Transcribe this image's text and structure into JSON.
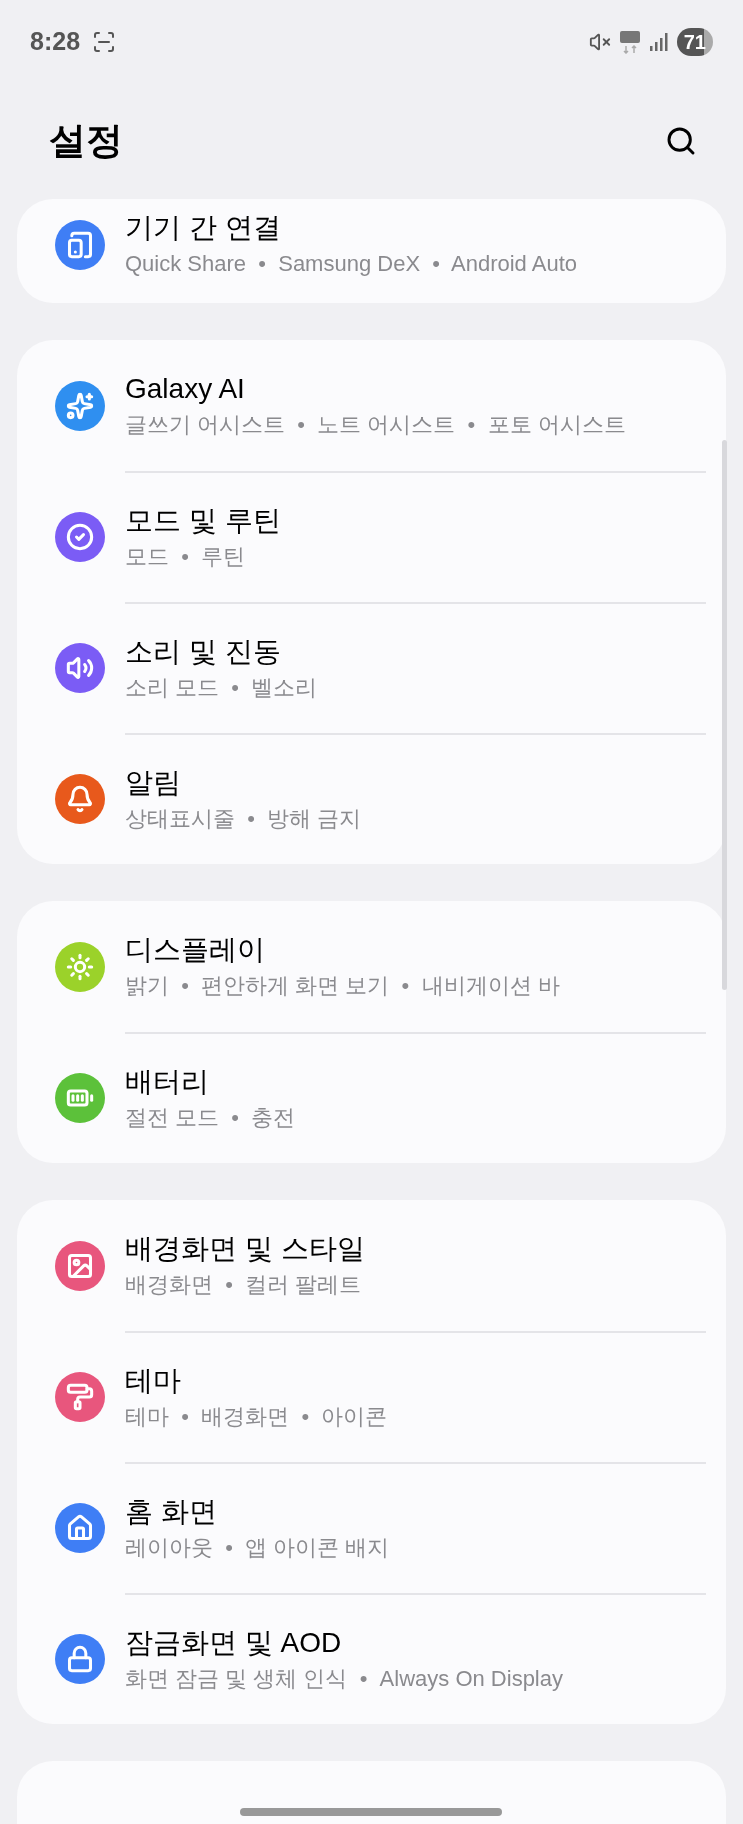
{
  "status_bar": {
    "time": "8:28",
    "battery": "71"
  },
  "header": {
    "title": "설정"
  },
  "groups": [
    {
      "cut_top": true,
      "items": [
        {
          "title": "기기 간 연결",
          "subtitle": "Quick Share  •  Samsung DeX  •  Android Auto",
          "color": "#3f7ef5"
        }
      ]
    },
    {
      "cut_top": false,
      "items": [
        {
          "title": "Galaxy AI",
          "subtitle": "글쓰기 어시스트  •  노트 어시스트  •  포토 어시스트",
          "color": "#2f8ff0"
        },
        {
          "title": "모드 및 루틴",
          "subtitle": "모드  •  루틴",
          "color": "#7b5cf5"
        },
        {
          "title": "소리 및 진동",
          "subtitle": "소리 모드  •  벨소리",
          "color": "#7b5cf5"
        },
        {
          "title": "알림",
          "subtitle": "상태표시줄  •  방해 금지",
          "color": "#e8591c"
        }
      ]
    },
    {
      "cut_top": false,
      "items": [
        {
          "title": "디스플레이",
          "subtitle": "밝기  •  편안하게 화면 보기  •  내비게이션 바",
          "color": "#9bd22a"
        },
        {
          "title": "배터리",
          "subtitle": "절전 모드  •  충전",
          "color": "#5cc13a"
        }
      ]
    },
    {
      "cut_top": false,
      "items": [
        {
          "title": "배경화면 및 스타일",
          "subtitle": "배경화면  •  컬러 팔레트",
          "color": "#e8567d"
        },
        {
          "title": "테마",
          "subtitle": "테마  •  배경화면  •  아이콘",
          "color": "#e8567d"
        },
        {
          "title": "홈 화면",
          "subtitle": "레이아웃  •  앱 아이콘 배지",
          "color": "#3f7ef5"
        },
        {
          "title": "잠금화면 및 AOD",
          "subtitle": "화면 잠금 및 생체 인식  •  Always On Display",
          "color": "#3f7ef5"
        }
      ]
    }
  ]
}
